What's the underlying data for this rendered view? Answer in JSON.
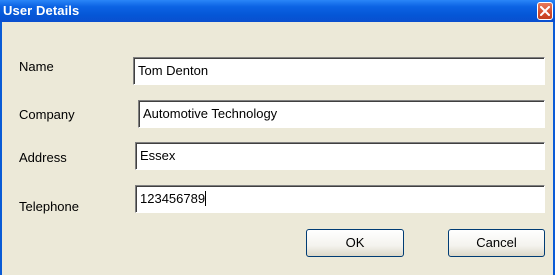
{
  "window": {
    "title": "User Details"
  },
  "form": {
    "fields": [
      {
        "label": "Name",
        "value": "Tom Denton"
      },
      {
        "label": "Company",
        "value": "Automotive Technology"
      },
      {
        "label": "Address",
        "value": "Essex"
      },
      {
        "label": "Telephone",
        "value": "123456789"
      }
    ]
  },
  "buttons": {
    "ok_label": "OK",
    "cancel_label": "Cancel"
  },
  "colors": {
    "titlebar": "#0556d6",
    "dialog_background": "#ece9d8",
    "close_button": "#d34b2b"
  },
  "icons": {
    "close": "close-icon"
  }
}
